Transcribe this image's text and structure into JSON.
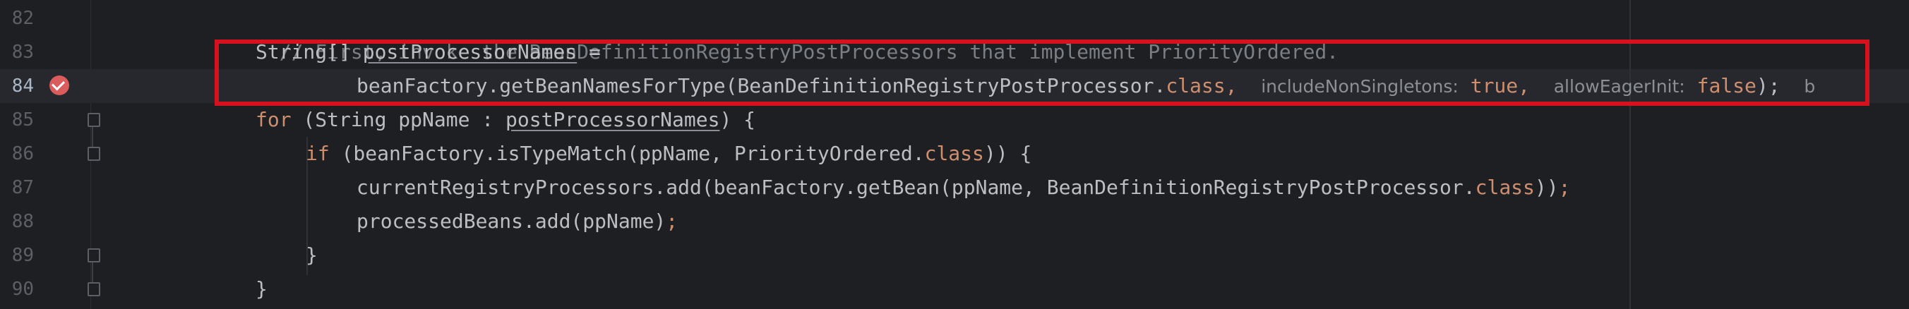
{
  "editor": {
    "lines": [
      {
        "num": "82",
        "comment": "// First, invoke the BeanDefinitionRegistryPostProcessors that implement PriorityOrdered."
      },
      {
        "num": "83",
        "type": "String[] ",
        "var": "postProcessorNames",
        "rest": " ="
      },
      {
        "num": "84",
        "call": "beanFactory.getBeanNamesForType(BeanDefinitionRegistryPostProcessor.",
        "cls": "class",
        "comma": ",",
        "hint1": "includeNonSingletons:",
        "val1": "true",
        "comma2": ",",
        "hint2": "allowEagerInit:",
        "val2": "false",
        "end": ");",
        "trail": "b"
      },
      {
        "num": "85",
        "kw": "for",
        "pre": " (String ppName : ",
        "var": "postProcessorNames",
        "post": ") {"
      },
      {
        "num": "86",
        "kw": "if",
        "pre": " (beanFactory.isTypeMatch(ppName, PriorityOrdered.",
        "cls": "class",
        "post": ")) {"
      },
      {
        "num": "87",
        "pre": "currentRegistryProcessors.add(beanFactory.getBean(ppName, BeanDefinitionRegistryPostProcessor.",
        "cls": "class",
        "post": "))",
        "semi": ";"
      },
      {
        "num": "88",
        "pre": "processedBeans.add(ppName)",
        "semi": ";"
      },
      {
        "num": "89",
        "text": "}"
      },
      {
        "num": "90",
        "text": "}"
      }
    ]
  },
  "gutter": {
    "breakpoint_line": "84",
    "breakpoint_icon": "breakpoint-verified-icon",
    "fold_icon": "fold-marker-icon"
  },
  "colors": {
    "background": "#1e1f22",
    "keyword": "#cf8e6d",
    "highlight_border": "#d6121f",
    "breakpoint": "#db5c5c"
  }
}
